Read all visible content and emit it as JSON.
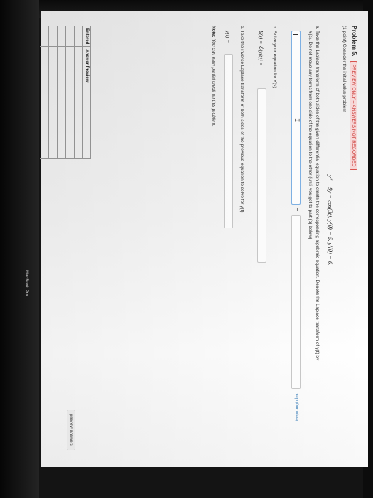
{
  "problem": {
    "title": "Problem 5.",
    "badge": "PREVIEW ONLY -- ANSWERS NOT RECORDED",
    "intro": "(1 point) Consider the initial value problem",
    "equation": "y″ + 9y = cos(3t),      y(0) = 5,   y′(0) = 6."
  },
  "part_a": {
    "text_line1": "a. Take the Laplace transform of both sides of the given differential equation to create the corresponding algebraic equation. Denote the Laplace transform of y(t) by",
    "text_line2": "Y(s). Do not move any terms from one side of the equation to the other (until you get to part (b) below).",
    "equals": "=",
    "help_link": "help (formulas)"
  },
  "part_b": {
    "text": "b. Solve your equation for Y(s).",
    "label": "Y(s) = ℒ{y(t)} ="
  },
  "part_c": {
    "text": "c. Take the inverse Laplace transform of both sides of the previous equation to solve for y(t).",
    "label": "y(t) ="
  },
  "note": {
    "label": "Note:",
    "text": "You can earn partial credit on this problem."
  },
  "preview_button": "preview answers",
  "table": {
    "headers": [
      "Entered",
      "Answer Preview"
    ]
  },
  "watermark": "MacBook Pro",
  "colors": {
    "badge_border": "#d9534f",
    "badge_bg": "#f7d9d9",
    "input_focus": "#7fb2e5",
    "link": "#337ab7"
  }
}
